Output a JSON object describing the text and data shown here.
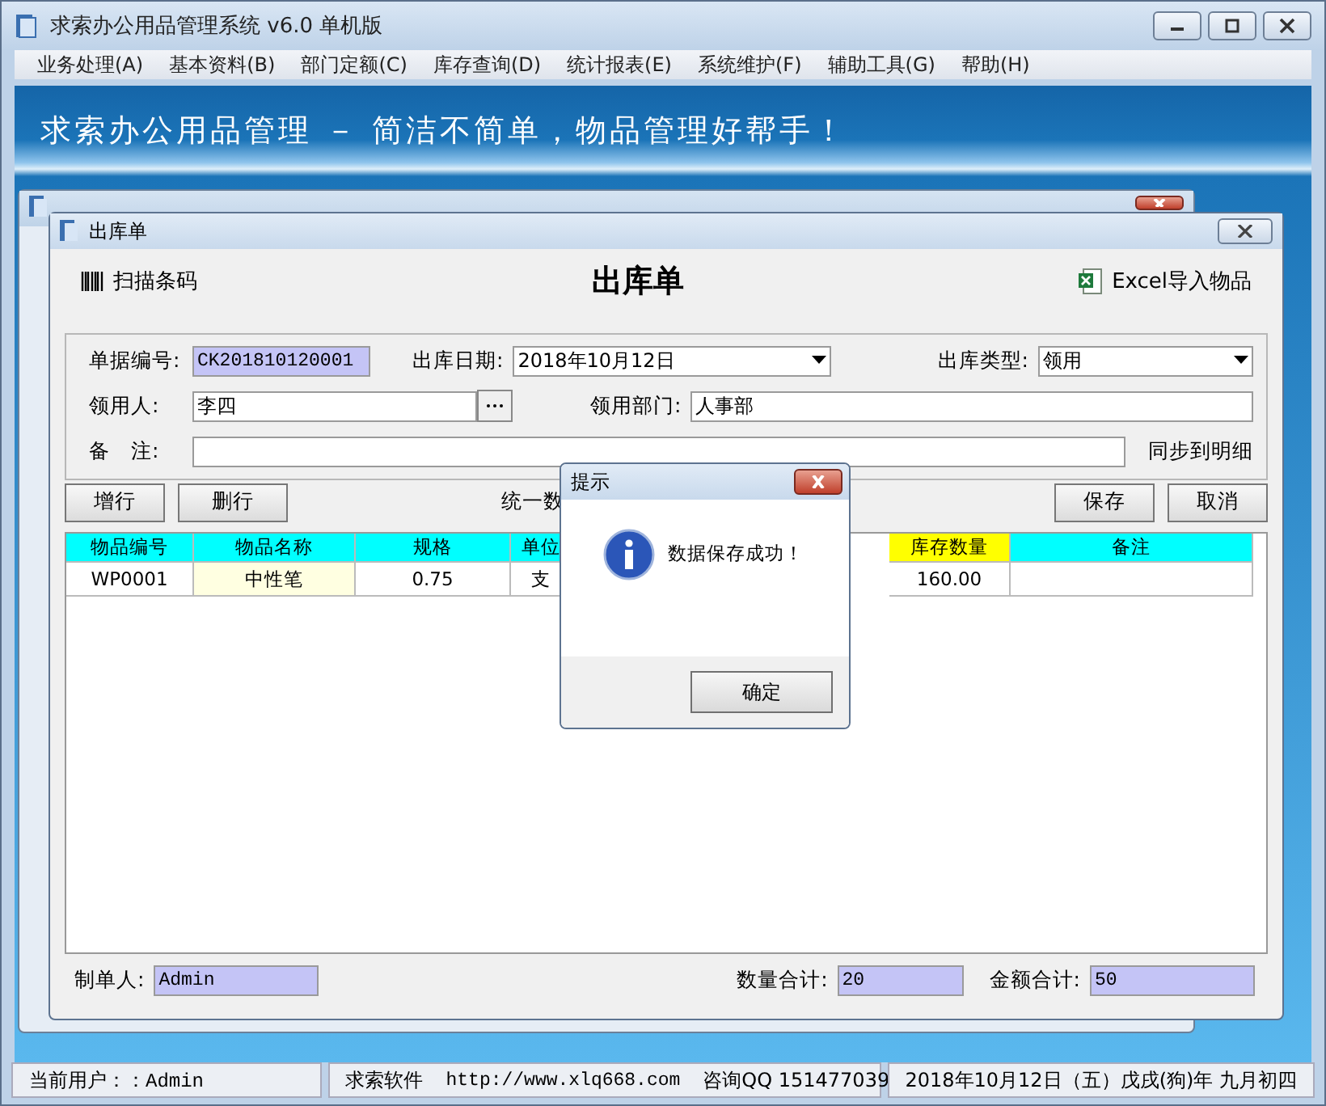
{
  "app": {
    "title": "求索办公用品管理系统 v6.0 单机版",
    "menu": [
      "业务处理(A)",
      "基本资料(B)",
      "部门定额(C)",
      "库存查询(D)",
      "统计报表(E)",
      "系统维护(F)",
      "辅助工具(G)",
      "帮助(H)"
    ],
    "banner": "求索办公用品管理 － 简洁不简单，物品管理好帮手！"
  },
  "form_window": {
    "title": "出库单",
    "scan_label": "扫描条码",
    "heading": "出库单",
    "excel_label": "Excel导入物品",
    "field_rows": [
      [
        {
          "label": "单据编号:",
          "value": "CK201810120001",
          "kind": "readonly"
        },
        {
          "label": "出库日期:",
          "value": "2018年10月12日",
          "kind": "dropdown"
        },
        {
          "label": "出库类型:",
          "value": "领用",
          "kind": "dropdown"
        }
      ],
      [
        {
          "label": "领用人:",
          "value": "李四",
          "kind": "picker"
        },
        {
          "label": "领用部门:",
          "value": "人事部",
          "kind": "text"
        }
      ],
      [
        {
          "label": "备　注:",
          "kind": "wide"
        }
      ]
    ],
    "sync_label": "同步到明细",
    "buttons_left": [
      "增行",
      "删行"
    ],
    "unify_label": "统一数",
    "buttons_right": [
      "保存",
      "取消"
    ],
    "table": {
      "columns": [
        {
          "label": "物品编号",
          "color": "#00ffff",
          "highlighted": false
        },
        {
          "label": "物品名称",
          "color": "#00ffff",
          "highlighted": true
        },
        {
          "label": "规格",
          "color": "#00ffff",
          "highlighted": false
        },
        {
          "label": "单位",
          "color": "#00ffff",
          "highlighted": false
        },
        {
          "label": "库存数量",
          "color": "#ffff00",
          "highlighted": false
        },
        {
          "label": "备注",
          "color": "#00ffff",
          "highlighted": false
        }
      ],
      "rows": [
        [
          "WP0001",
          "中性笔",
          "0.75",
          "支",
          "160.00",
          ""
        ]
      ]
    },
    "footer": [
      {
        "label": "制单人:",
        "value": "Admin"
      },
      {
        "label": "数量合计:",
        "value": "20"
      },
      {
        "label": "金额合计:",
        "value": "50"
      }
    ]
  },
  "dialog": {
    "title": "提示",
    "message": "数据保存成功！",
    "button": "确定"
  },
  "status_bar": [
    "当前用户：：Admin",
    "求索软件",
    "http://www.xlq668.com",
    "咨询QQ 151477039",
    "2018年10月12日（五）戊戌(狗)年 九月初四"
  ]
}
